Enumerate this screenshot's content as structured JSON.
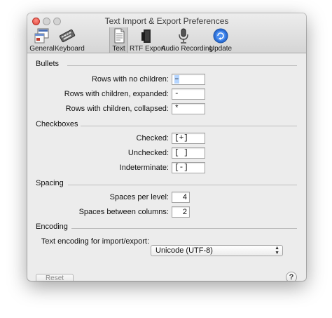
{
  "window": {
    "title": "Text Import & Export Preferences"
  },
  "toolbar": {
    "items": [
      {
        "label": "General",
        "icon": "general-icon"
      },
      {
        "label": "Keyboard",
        "icon": "keyboard-icon"
      },
      {
        "label": "Text",
        "icon": "text-document-icon",
        "selected": true
      },
      {
        "label": "RTF Export",
        "icon": "rtf-export-icon"
      },
      {
        "label": "Audio Recording",
        "icon": "microphone-icon"
      },
      {
        "label": "Update",
        "icon": "update-icon"
      }
    ]
  },
  "bullets": {
    "heading": "Bullets",
    "rows": [
      {
        "label": "Rows with no children:",
        "value": "–"
      },
      {
        "label": "Rows with children, expanded:",
        "value": "-"
      },
      {
        "label": "Rows with children, collapsed:",
        "value": "*"
      }
    ]
  },
  "checkboxes": {
    "heading": "Checkboxes",
    "rows": [
      {
        "label": "Checked:",
        "value": "[+]"
      },
      {
        "label": "Unchecked:",
        "value": "[ ]"
      },
      {
        "label": "Indeterminate:",
        "value": "[-]"
      }
    ]
  },
  "spacing": {
    "heading": "Spacing",
    "rows": [
      {
        "label": "Spaces per level:",
        "value": "4"
      },
      {
        "label": "Spaces between columns:",
        "value": "2"
      }
    ]
  },
  "encoding": {
    "heading": "Encoding",
    "label": "Text encoding for import/export:",
    "value": "Unicode (UTF-8)"
  },
  "footer": {
    "reset_label": "Reset",
    "help_label": "?"
  }
}
